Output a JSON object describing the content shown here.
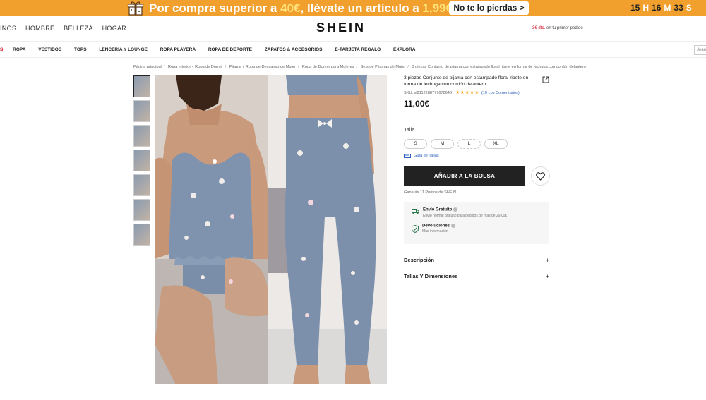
{
  "promo": {
    "text_prefix": "Por compra superior a ",
    "amount": "40€",
    "text_mid": ",  llévate un artículo a ",
    "special_price": "1,99€",
    "cta": "No te lo pierdas >",
    "countdown": {
      "hours": "15",
      "h": "H",
      "minutes": "16",
      "m": "M",
      "seconds": "33",
      "s": "S"
    }
  },
  "header": {
    "topnav": [
      "IÑOS",
      "HOMBRE",
      "BELLEZA",
      "HOGAR"
    ],
    "logo": "SHEIN",
    "first_order_discount": "3€ dto.",
    "first_order_text": " en tu primer pedido"
  },
  "catnav": {
    "items": [
      "S",
      "ROPA",
      "VESTIDOS",
      "TOPS",
      "LENCERÍA Y LOUNGE",
      "ROPA PLAYERA",
      "ROPA DE DEPORTE",
      "ZAPATOS & ACCESORIOS",
      "E-TARJETA REGALO",
      "EXPLORA"
    ],
    "search_placeholder": "Jean"
  },
  "breadcrumb": [
    "Página principal",
    "Ropa Interior y Ropa de Dormir",
    "Pijama y Ropa de Descanso de Mujer",
    "Ropa de Dormir para Mujeres",
    "Sets de Pijamas de Mujer",
    "3 piezas Conjunto de pijama con estampado floral ribete en forma de lechuga con cordón delantero"
  ],
  "product": {
    "title": "3 piezas Conjunto de pijama con estampado floral ribete en forma de lechuga con cordón delantero",
    "sku": "SKU: sl2112288777678646",
    "rating_stars": "★★★★★",
    "reviews": "(10 Los Comentarios)",
    "price": "11,00€",
    "size_label": "Talla",
    "sizes": [
      "S",
      "M",
      "L",
      "XL"
    ],
    "size_guide": "Guía de Tallas",
    "add_to_bag": "AÑADIR A LA BOLSA",
    "points": "Ganarás 11 Puntos de SHEIN",
    "shipping": {
      "title": "Envío Gratuito",
      "sub": "Envío normal gratuito para pedidos de más de 29,00€"
    },
    "returns": {
      "title": "Devoluciones",
      "sub": "Más información"
    },
    "accordion": [
      {
        "label": "Descripción",
        "icon": "+"
      },
      {
        "label": "Tallas Y Dimensiones",
        "icon": "+"
      }
    ]
  },
  "colors": {
    "promo": "#f2a02d",
    "accent_red": "#d0021b",
    "link_blue": "#2c5fb8",
    "star": "#f5a623"
  }
}
